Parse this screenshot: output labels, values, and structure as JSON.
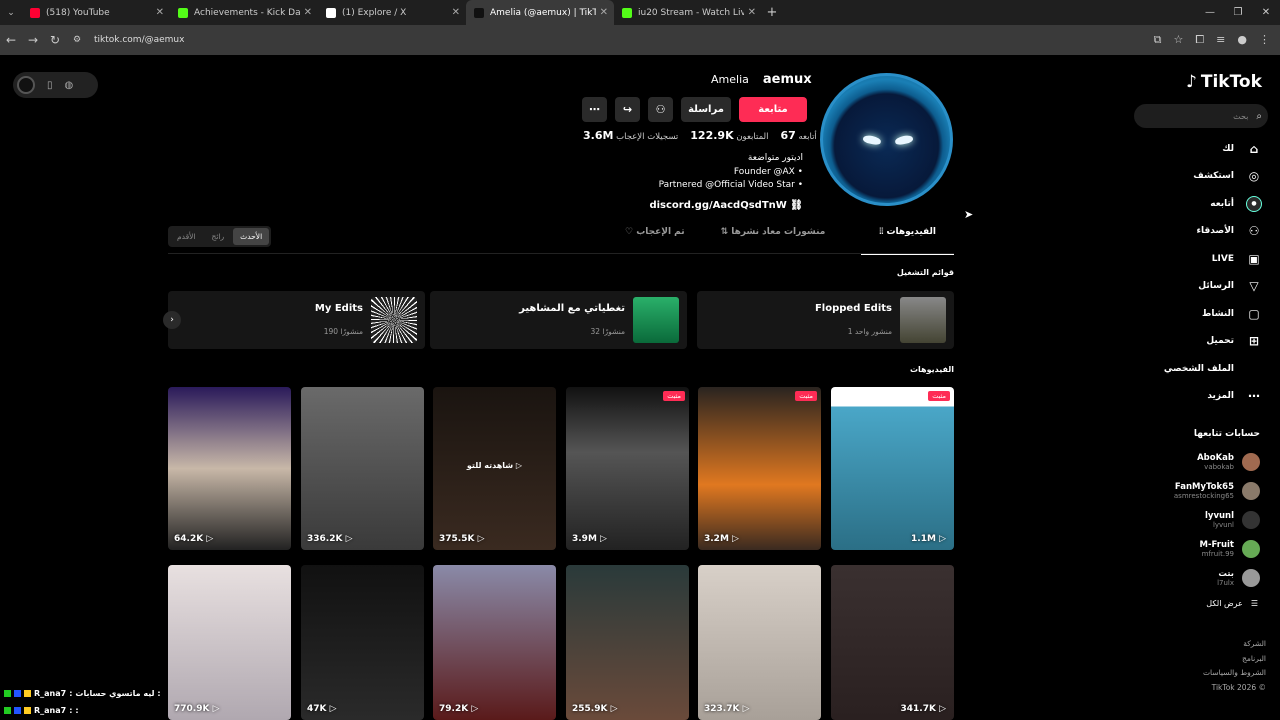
{
  "browser": {
    "tabs": [
      {
        "title": "(518) YouTube",
        "color": "#ff0033",
        "active": false
      },
      {
        "title": "Achievements - Kick Dashboard",
        "color": "#53fc18",
        "active": false
      },
      {
        "title": "(1) Explore / X",
        "color": "#ffffff",
        "active": false
      },
      {
        "title": "Amelia (@aemux) | TikTok",
        "color": "#111111",
        "active": true
      },
      {
        "title": "iu20 Stream - Watch Live on Ki...",
        "color": "#53fc18",
        "active": false
      }
    ],
    "url": "tiktok.com/@aemux"
  },
  "tiktok": {
    "logo": "TikTok",
    "search_placeholder": "بحث",
    "nav": [
      {
        "label": "لك",
        "icon": "home-icon",
        "glyph": "⌂"
      },
      {
        "label": "استكشف",
        "icon": "compass-icon",
        "glyph": "◎"
      },
      {
        "label": "أتابعه",
        "icon": "following-icon",
        "glyph": "●"
      },
      {
        "label": "الأصدقاء",
        "icon": "friends-icon",
        "glyph": "⚇"
      },
      {
        "label": "LIVE",
        "icon": "live-icon",
        "glyph": "▣"
      },
      {
        "label": "الرسائل",
        "icon": "messages-icon",
        "glyph": "▽"
      },
      {
        "label": "النشاط",
        "icon": "activity-icon",
        "glyph": "▢"
      },
      {
        "label": "تحميل",
        "icon": "upload-icon",
        "glyph": "⊞"
      },
      {
        "label": "الملف الشخصي",
        "icon": "profile-icon",
        "glyph": ""
      },
      {
        "label": "المزيد",
        "icon": "more-icon",
        "glyph": "⋯"
      }
    ],
    "following_heading": "حسابات تتابعها",
    "following": [
      {
        "name": "AboKab",
        "handle": "vabokab"
      },
      {
        "name": "FanMyTok65",
        "handle": "asmrestocking65"
      },
      {
        "name": "lyvunl",
        "handle": "lyvunl"
      },
      {
        "name": "M-Fruit",
        "handle": "mfruit.99"
      },
      {
        "name": "بتت",
        "handle": "l7ulx"
      }
    ],
    "see_all": "عرض الكل",
    "footer": [
      "الشركة",
      "البرنامج",
      "الشروط والسياسات",
      "TikTok 2026 ©"
    ]
  },
  "profile": {
    "display_name": "aemux",
    "username": "Amelia",
    "follow_btn": "متابعة",
    "message_btn": "مراسلة",
    "stats": [
      {
        "value": "67",
        "label": "أتابعه"
      },
      {
        "value": "122.9K",
        "label": "المتابعون"
      },
      {
        "value": "3.6M",
        "label": "تسجيلات الإعجاب"
      }
    ],
    "bio": [
      "اديتور متواضعة",
      "Founder @AX •",
      "Partnered @Official Video Star •"
    ],
    "link": "discord.gg/AacdQsdTnW",
    "sort": [
      "الأحدث",
      "رائج",
      "الأقدم"
    ],
    "tabs": [
      "الفيديوهات",
      "منشورات معاد نشرها",
      "تم الإعجاب"
    ],
    "playlists_heading": "قوائم التشغيل",
    "playlists": [
      {
        "title": "Flopped Edits",
        "count": "منشور واحد 1"
      },
      {
        "title": "تغطياتي مع المشاهير",
        "count": "32 منشورًا"
      },
      {
        "title": "My Edits",
        "count": "190 منشورًا"
      }
    ],
    "videos_heading": "الفيديوهات",
    "pinned_label": "مثبت",
    "overlay_text": "شاهدته للتو",
    "videos": [
      {
        "views": "1.1M",
        "pinned": true
      },
      {
        "views": "3.2M",
        "pinned": true
      },
      {
        "views": "3.9M",
        "pinned": true
      },
      {
        "views": "375.5K",
        "pinned": false
      },
      {
        "views": "336.2K",
        "pinned": false
      },
      {
        "views": "64.2K",
        "pinned": false
      },
      {
        "views": "341.7K",
        "pinned": false
      },
      {
        "views": "323.7K",
        "pinned": false
      },
      {
        "views": "255.9K",
        "pinned": false
      },
      {
        "views": "79.2K",
        "pinned": false
      },
      {
        "views": "47K",
        "pinned": false
      },
      {
        "views": "770.9K",
        "pinned": false
      }
    ]
  },
  "chat": [
    {
      "user": "R_ana7",
      "text": "ليه ماتسوي حسابات :"
    },
    {
      "user": "R_ana7",
      "text": ":"
    }
  ]
}
